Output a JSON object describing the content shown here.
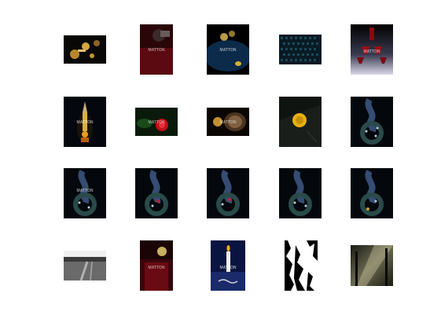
{
  "figure": {
    "background": "#ffffff",
    "watermark_text": "MATTON",
    "thumbnails": [
      {
        "name": "thumb-clock-gears",
        "desc_icon": "photo",
        "watermark": false
      },
      {
        "name": "thumb-dark-red-scene",
        "desc_icon": "photo",
        "watermark": true
      },
      {
        "name": "thumb-blue-gold-still-life",
        "desc_icon": "photo",
        "watermark": true
      },
      {
        "name": "thumb-blue-pattern",
        "desc_icon": "photo",
        "watermark": false
      },
      {
        "name": "thumb-wine-glasses",
        "desc_icon": "photo",
        "watermark": true
      },
      {
        "name": "thumb-night-tower",
        "desc_icon": "photo",
        "watermark": true
      },
      {
        "name": "thumb-red-flower",
        "desc_icon": "photo",
        "watermark": true
      },
      {
        "name": "thumb-gold-watch",
        "desc_icon": "photo",
        "watermark": true
      },
      {
        "name": "thumb-yellow-disc",
        "desc_icon": "photo",
        "watermark": false
      },
      {
        "name": "thumb-wreath-1",
        "desc_icon": "photo",
        "watermark": false
      },
      {
        "name": "thumb-wreath-2",
        "desc_icon": "photo",
        "watermark": true
      },
      {
        "name": "thumb-wreath-3",
        "desc_icon": "photo",
        "watermark": false
      },
      {
        "name": "thumb-wreath-4",
        "desc_icon": "photo",
        "watermark": false
      },
      {
        "name": "thumb-wreath-5",
        "desc_icon": "photo",
        "watermark": false
      },
      {
        "name": "thumb-wreath-6",
        "desc_icon": "photo",
        "watermark": false
      },
      {
        "name": "thumb-field-path",
        "desc_icon": "photo",
        "watermark": false
      },
      {
        "name": "thumb-red-bottle",
        "desc_icon": "photo",
        "watermark": true
      },
      {
        "name": "thumb-candle",
        "desc_icon": "photo",
        "watermark": true
      },
      {
        "name": "thumb-bw-silhouette",
        "desc_icon": "photo",
        "watermark": false
      },
      {
        "name": "thumb-forest-light",
        "desc_icon": "photo",
        "watermark": false
      }
    ]
  }
}
